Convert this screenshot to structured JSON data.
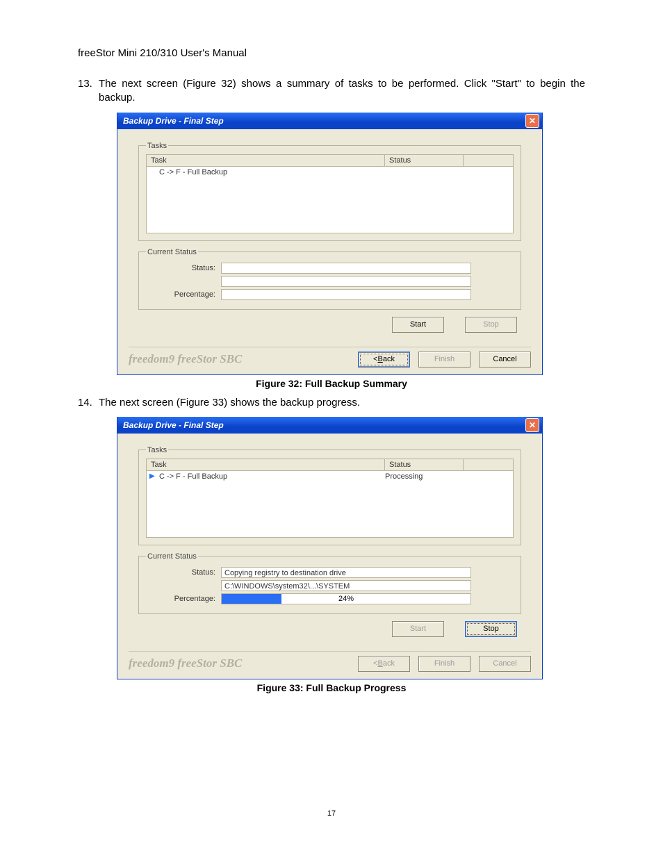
{
  "doc": {
    "header": "freeStor Mini 210/310 User's Manual",
    "step13_num": "13.",
    "step13_text": "The next screen (Figure 32) shows a summary of tasks to be performed. Click \"Start\" to begin the backup.",
    "step14_num": "14.",
    "step14_text": "The next screen (Figure 33) shows the backup progress.",
    "caption32": "Figure 32: Full Backup Summary",
    "caption33": "Figure 33: Full Backup Progress",
    "page_number": "17"
  },
  "dlg32": {
    "title": "Backup Drive - Final Step",
    "tasks_legend": "Tasks",
    "col_task": "Task",
    "col_status": "Status",
    "row1_task": "C -> F - Full Backup",
    "row1_status": "",
    "cs_legend": "Current Status",
    "lbl_status": "Status:",
    "lbl_percentage": "Percentage:",
    "status_line1": "",
    "status_line2": "",
    "percentage_text": "",
    "percentage_fill": "0%",
    "btn_start": "Start",
    "btn_stop": "Stop",
    "brand": "freedom9 freeStor SBC",
    "btn_back_prefix": "< ",
    "btn_back_ul": "B",
    "btn_back_suffix": "ack",
    "btn_finish": "Finish",
    "btn_cancel": "Cancel"
  },
  "dlg33": {
    "title": "Backup Drive - Final Step",
    "tasks_legend": "Tasks",
    "col_task": "Task",
    "col_status": "Status",
    "row1_task": "C -> F - Full Backup",
    "row1_status": "Processing",
    "cs_legend": "Current Status",
    "lbl_status": "Status:",
    "lbl_percentage": "Percentage:",
    "status_line1": "Copying registry to destination drive",
    "status_line2": "C:\\WINDOWS\\system32\\...\\SYSTEM",
    "percentage_text": "24%",
    "percentage_fill": "24%",
    "btn_start": "Start",
    "btn_stop": "Stop",
    "brand": "freedom9 freeStor SBC",
    "btn_back_prefix": "< ",
    "btn_back_ul": "B",
    "btn_back_suffix": "ack",
    "btn_finish": "Finish",
    "btn_cancel": "Cancel"
  }
}
